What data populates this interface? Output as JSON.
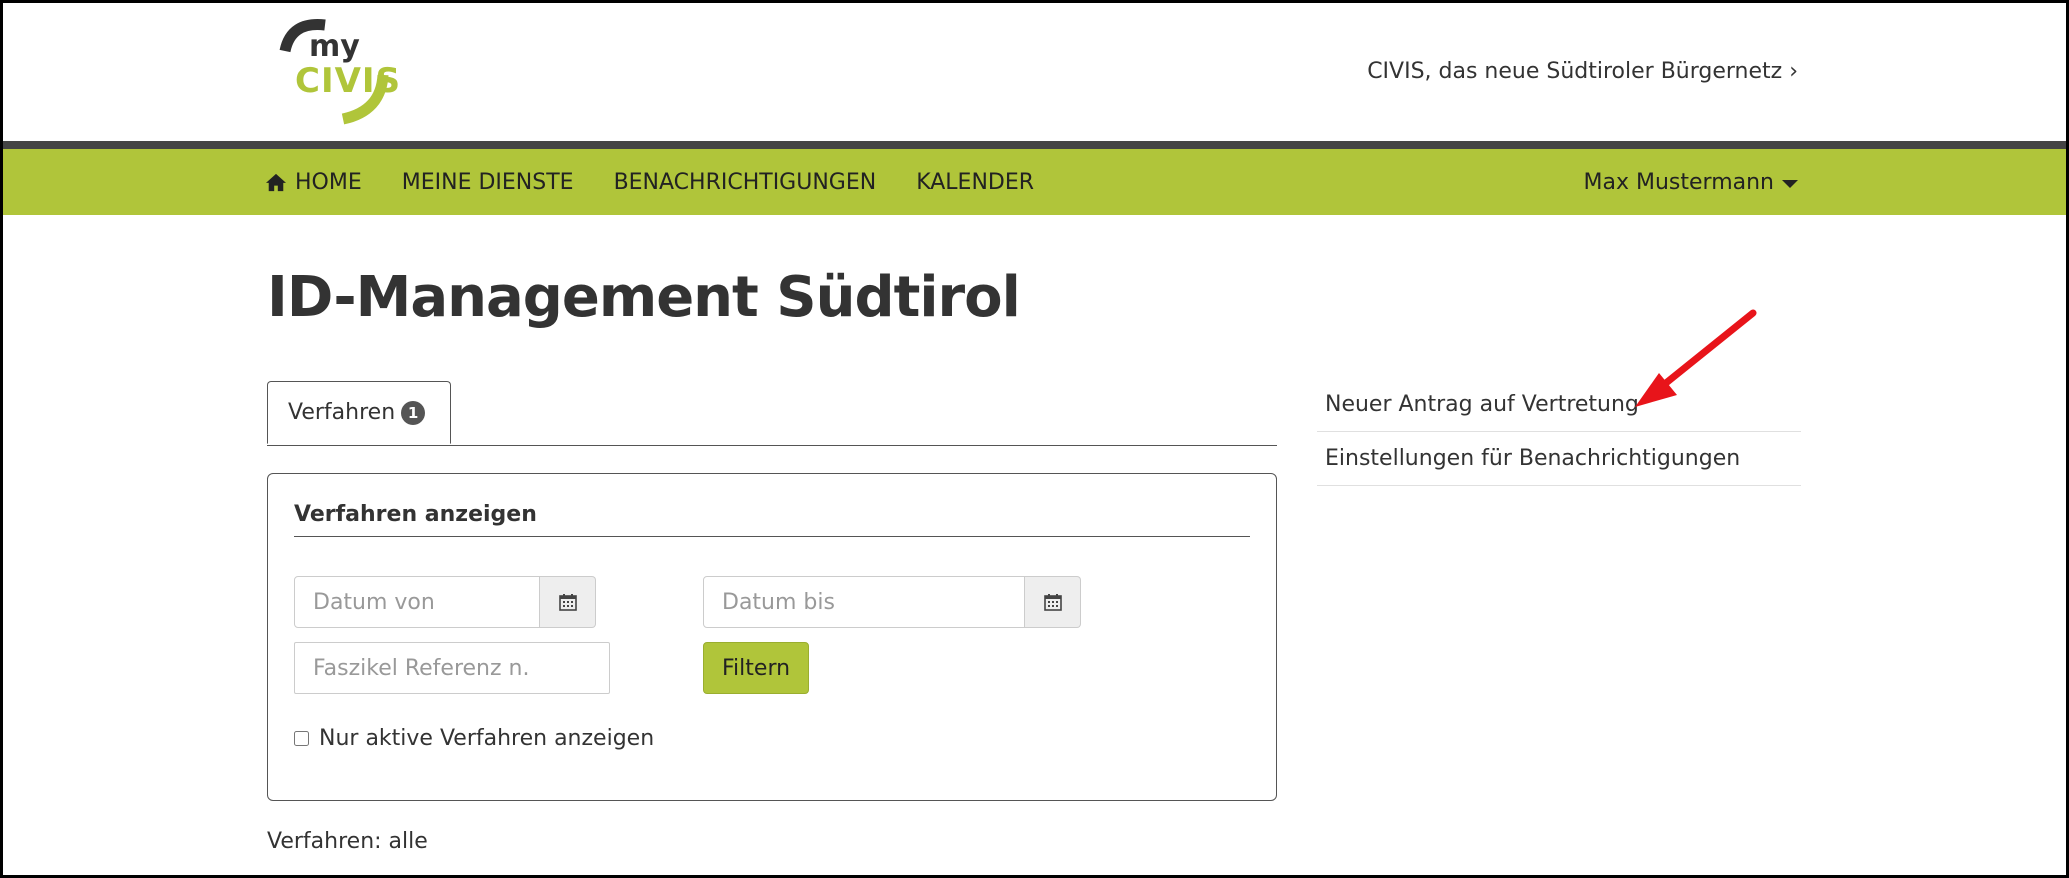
{
  "header": {
    "logo": {
      "line1": "my",
      "line2": "CIVIS"
    },
    "top_link": "CIVIS, das neue Südtiroler Bürgernetz ›"
  },
  "nav": {
    "items": [
      {
        "label": "HOME",
        "icon": "home-icon"
      },
      {
        "label": "MEINE DIENSTE"
      },
      {
        "label": "BENACHRICHTIGUNGEN"
      },
      {
        "label": "KALENDER"
      }
    ],
    "user": "Max Mustermann"
  },
  "main": {
    "title": "ID-Management Südtirol",
    "tabs": [
      {
        "label": "Verfahren",
        "badge": "1"
      }
    ],
    "filter_panel": {
      "title": "Verfahren anzeigen",
      "date_from_placeholder": "Datum von",
      "date_to_placeholder": "Datum bis",
      "reference_placeholder": "Faszikel Referenz n.",
      "filter_button": "Filtern",
      "active_only_label": "Nur aktive Verfahren anzeigen",
      "active_only_checked": false
    },
    "summary": "Verfahren: alle"
  },
  "sidebar": {
    "links": [
      {
        "label": "Neuer Antrag auf Vertretung"
      },
      {
        "label": "Einstellungen für Benachrichtigungen"
      }
    ]
  },
  "colors": {
    "brand_green": "#b0c53a",
    "nav_border": "#444444",
    "annotation_arrow": "#e8141a"
  }
}
